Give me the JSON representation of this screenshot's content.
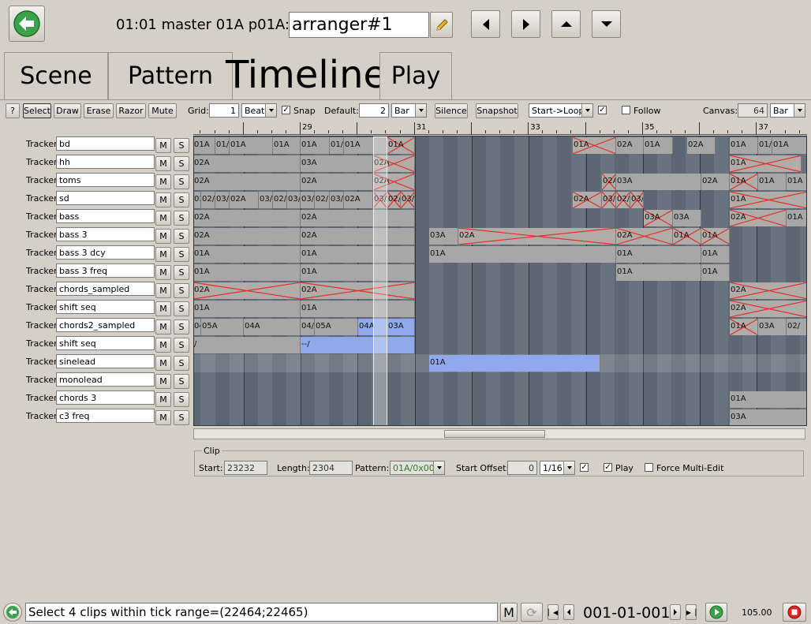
{
  "header": {
    "location_label": "01:01 master 01A p01A:",
    "name_value": "arranger#1"
  },
  "tabs": [
    {
      "label": "Scene"
    },
    {
      "label": "Pattern"
    },
    {
      "label": "Timeline"
    },
    {
      "label": "Play"
    }
  ],
  "toolbar": {
    "help": "?",
    "select": "Select",
    "draw": "Draw",
    "erase": "Erase",
    "razor": "Razor",
    "mute": "Mute",
    "grid_label": "Grid:",
    "grid_value": "1",
    "grid_unit": "Beat",
    "snap_label": "Snap",
    "snap_checked": true,
    "default_label": "Default:",
    "default_value": "2",
    "default_unit": "Bar",
    "silence": "Silence",
    "snapshot": "Snapshot",
    "loop_mode": "Start->Loop",
    "loop_checked": true,
    "follow_label": "Follow",
    "follow_checked": false,
    "canvas_label": "Canvas:",
    "canvas_value": "64",
    "canvas_unit": "Bar"
  },
  "ruler": {
    "bars": [
      "29",
      "31",
      "33",
      "35",
      "37"
    ]
  },
  "tracks": [
    {
      "type": "Tracker",
      "name": "bd",
      "mute": "M",
      "solo": "S"
    },
    {
      "type": "Tracker",
      "name": "hh",
      "mute": "M",
      "solo": "S"
    },
    {
      "type": "Tracker",
      "name": "toms",
      "mute": "M",
      "solo": "S"
    },
    {
      "type": "Tracker",
      "name": "sd",
      "mute": "M",
      "solo": "S"
    },
    {
      "type": "Tracker",
      "name": "bass",
      "mute": "M",
      "solo": "S"
    },
    {
      "type": "Tracker",
      "name": "bass 3",
      "mute": "M",
      "solo": "S"
    },
    {
      "type": "Tracker",
      "name": "bass 3 dcy",
      "mute": "M",
      "solo": "S"
    },
    {
      "type": "Tracker",
      "name": "bass 3 freq",
      "mute": "M",
      "solo": "S"
    },
    {
      "type": "Tracker",
      "name": "chords_sampled",
      "mute": "M",
      "solo": "S"
    },
    {
      "type": "Tracker",
      "name": "shift seq",
      "mute": "M",
      "solo": "S"
    },
    {
      "type": "Tracker",
      "name": "chords2_sampled",
      "mute": "M",
      "solo": "S"
    },
    {
      "type": "Tracker",
      "name": "shift seq",
      "mute": "M",
      "solo": "S"
    },
    {
      "type": "Tracker",
      "name": "sinelead",
      "mute": "M",
      "solo": "S"
    },
    {
      "type": "Tracker",
      "name": "monolead",
      "mute": "M",
      "solo": "S"
    },
    {
      "type": "Tracker",
      "name": "chords 3",
      "mute": "M",
      "solo": "S"
    },
    {
      "type": "Tracker",
      "name": "c3 freq",
      "mute": "M",
      "solo": "S"
    }
  ],
  "clips": [
    {
      "t": 0,
      "s": 244,
      "e": 272,
      "l": "01A"
    },
    {
      "t": 0,
      "s": 272,
      "e": 290,
      "l": "01/"
    },
    {
      "t": 0,
      "s": 290,
      "e": 345,
      "l": "01A"
    },
    {
      "t": 0,
      "s": 345,
      "e": 380,
      "l": "01A"
    },
    {
      "t": 0,
      "s": 380,
      "e": 417,
      "l": "01A"
    },
    {
      "t": 0,
      "s": 417,
      "e": 435,
      "l": "01/"
    },
    {
      "t": 0,
      "s": 435,
      "e": 490,
      "l": "01A"
    },
    {
      "t": 0,
      "s": 490,
      "e": 525,
      "l": "01A",
      "m": true
    },
    {
      "t": 0,
      "s": 725,
      "e": 780,
      "l": "01A",
      "m": true
    },
    {
      "t": 0,
      "s": 780,
      "e": 815,
      "l": "02A"
    },
    {
      "t": 0,
      "s": 815,
      "e": 852,
      "l": "01A"
    },
    {
      "t": 0,
      "s": 870,
      "e": 906,
      "l": "02A"
    },
    {
      "t": 0,
      "s": 924,
      "e": 960,
      "l": "01A"
    },
    {
      "t": 0,
      "s": 960,
      "e": 978,
      "l": "01/"
    },
    {
      "t": 0,
      "s": 978,
      "e": 1023,
      "l": "01A"
    },
    {
      "t": 1,
      "s": 244,
      "e": 380,
      "l": "02A"
    },
    {
      "t": 1,
      "s": 380,
      "e": 472,
      "l": "03A"
    },
    {
      "t": 1,
      "s": 472,
      "e": 525,
      "l": "02A",
      "m": true
    },
    {
      "t": 1,
      "s": 924,
      "e": 1015,
      "l": "01A",
      "m": true
    },
    {
      "t": 2,
      "s": 244,
      "e": 380,
      "l": "02A"
    },
    {
      "t": 2,
      "s": 380,
      "e": 472,
      "l": "02A"
    },
    {
      "t": 2,
      "s": 472,
      "e": 525,
      "l": "02A",
      "m": true
    },
    {
      "t": 2,
      "s": 762,
      "e": 780,
      "l": "02A",
      "m": true
    },
    {
      "t": 2,
      "s": 780,
      "e": 888,
      "l": "03A"
    },
    {
      "t": 2,
      "s": 888,
      "e": 924,
      "l": "02A"
    },
    {
      "t": 2,
      "s": 924,
      "e": 960,
      "l": "01A",
      "m": true
    },
    {
      "t": 2,
      "s": 960,
      "e": 996,
      "l": "01A"
    },
    {
      "t": 2,
      "s": 996,
      "e": 1023,
      "l": "01A"
    },
    {
      "t": 3,
      "s": 244,
      "e": 254,
      "l": "03/"
    },
    {
      "t": 3,
      "s": 254,
      "e": 272,
      "l": "02/"
    },
    {
      "t": 3,
      "s": 272,
      "e": 290,
      "l": "03/"
    },
    {
      "t": 3,
      "s": 290,
      "e": 327,
      "l": "02A"
    },
    {
      "t": 3,
      "s": 327,
      "e": 345,
      "l": "03/"
    },
    {
      "t": 3,
      "s": 345,
      "e": 363,
      "l": "02/"
    },
    {
      "t": 3,
      "s": 363,
      "e": 380,
      "l": "03/"
    },
    {
      "t": 3,
      "s": 380,
      "e": 398,
      "l": "03/"
    },
    {
      "t": 3,
      "s": 398,
      "e": 417,
      "l": "02/"
    },
    {
      "t": 3,
      "s": 417,
      "e": 435,
      "l": "03/"
    },
    {
      "t": 3,
      "s": 435,
      "e": 472,
      "l": "02A"
    },
    {
      "t": 3,
      "s": 472,
      "e": 490,
      "l": "03/",
      "m": true
    },
    {
      "t": 3,
      "s": 490,
      "e": 507,
      "l": "02/",
      "m": true
    },
    {
      "t": 3,
      "s": 507,
      "e": 525,
      "l": "03/",
      "m": true
    },
    {
      "t": 3,
      "s": 725,
      "e": 762,
      "l": "02A",
      "m": true
    },
    {
      "t": 3,
      "s": 762,
      "e": 780,
      "l": "03/",
      "m": true
    },
    {
      "t": 3,
      "s": 780,
      "e": 798,
      "l": "02/",
      "m": true
    },
    {
      "t": 3,
      "s": 798,
      "e": 815,
      "l": "03/",
      "m": true
    },
    {
      "t": 3,
      "s": 924,
      "e": 1023,
      "l": "01A",
      "m": true
    },
    {
      "t": 4,
      "s": 244,
      "e": 380,
      "l": "02A"
    },
    {
      "t": 4,
      "s": 380,
      "e": 525,
      "l": "02A"
    },
    {
      "t": 4,
      "s": 815,
      "e": 852,
      "l": "03A",
      "m": true
    },
    {
      "t": 4,
      "s": 852,
      "e": 888,
      "l": "03A"
    },
    {
      "t": 4,
      "s": 924,
      "e": 996,
      "l": "02A",
      "m": true
    },
    {
      "t": 4,
      "s": 996,
      "e": 1023,
      "l": "01A"
    },
    {
      "t": 5,
      "s": 244,
      "e": 380,
      "l": "02A"
    },
    {
      "t": 5,
      "s": 380,
      "e": 525,
      "l": "02A"
    },
    {
      "t": 5,
      "s": 543,
      "e": 580,
      "l": "03A"
    },
    {
      "t": 5,
      "s": 580,
      "e": 780,
      "l": "02A",
      "m": true
    },
    {
      "t": 5,
      "s": 780,
      "e": 852,
      "l": "02A",
      "m": true
    },
    {
      "t": 5,
      "s": 852,
      "e": 888,
      "l": "01A",
      "m": true
    },
    {
      "t": 5,
      "s": 888,
      "e": 924,
      "l": "01A",
      "m": true
    },
    {
      "t": 6,
      "s": 244,
      "e": 380,
      "l": "01A"
    },
    {
      "t": 6,
      "s": 380,
      "e": 525,
      "l": "01A"
    },
    {
      "t": 6,
      "s": 543,
      "e": 780,
      "l": "01A"
    },
    {
      "t": 6,
      "s": 780,
      "e": 888,
      "l": "01A"
    },
    {
      "t": 6,
      "s": 888,
      "e": 924,
      "l": "01A"
    },
    {
      "t": 7,
      "s": 244,
      "e": 380,
      "l": "01A"
    },
    {
      "t": 7,
      "s": 380,
      "e": 525,
      "l": "01A"
    },
    {
      "t": 7,
      "s": 780,
      "e": 888,
      "l": "01A"
    },
    {
      "t": 7,
      "s": 888,
      "e": 924,
      "l": "01A"
    },
    {
      "t": 8,
      "s": 244,
      "e": 380,
      "l": "02A",
      "m": true
    },
    {
      "t": 8,
      "s": 380,
      "e": 525,
      "l": "02A",
      "m": true
    },
    {
      "t": 8,
      "s": 924,
      "e": 1023,
      "l": "02A",
      "m": true
    },
    {
      "t": 9,
      "s": 244,
      "e": 380,
      "l": "01A"
    },
    {
      "t": 9,
      "s": 380,
      "e": 525,
      "l": "01A"
    },
    {
      "t": 9,
      "s": 924,
      "e": 1023,
      "l": "02A",
      "m": true
    },
    {
      "t": 10,
      "s": 244,
      "e": 254,
      "l": "04/"
    },
    {
      "t": 10,
      "s": 254,
      "e": 308,
      "l": "05A"
    },
    {
      "t": 10,
      "s": 308,
      "e": 380,
      "l": "04A"
    },
    {
      "t": 10,
      "s": 380,
      "e": 398,
      "l": "04/"
    },
    {
      "t": 10,
      "s": 398,
      "e": 453,
      "l": "05A"
    },
    {
      "t": 10,
      "s": 453,
      "e": 490,
      "l": "04A",
      "b": true
    },
    {
      "t": 10,
      "s": 490,
      "e": 525,
      "l": "03A",
      "b": true
    },
    {
      "t": 10,
      "s": 924,
      "e": 960,
      "l": "01A",
      "m": true
    },
    {
      "t": 10,
      "s": 960,
      "e": 996,
      "l": "03A"
    },
    {
      "t": 10,
      "s": 996,
      "e": 1023,
      "l": "02/"
    },
    {
      "t": 11,
      "s": 244,
      "e": 380,
      "l": "/"
    },
    {
      "t": 11,
      "s": 380,
      "e": 525,
      "l": "--/",
      "b": true
    },
    {
      "t": 12,
      "s": 543,
      "e": 760,
      "l": "01A",
      "b": true
    },
    {
      "t": 14,
      "s": 924,
      "e": 1023,
      "l": "01A"
    },
    {
      "t": 15,
      "s": 924,
      "e": 1023,
      "l": "03A"
    }
  ],
  "clip_panel": {
    "title": "Clip",
    "start_label": "Start:",
    "start_value": "23232",
    "length_label": "Length:",
    "length_value": "2304",
    "pattern_label": "Pattern:",
    "pattern_value": "01A/0x00",
    "offset_label": "Start Offset:",
    "offset_value": "0",
    "offset_unit": "1/16",
    "offset_checked": true,
    "play_label": "Play",
    "play_checked": true,
    "force_label": "Force Multi-Edit",
    "force_checked": false
  },
  "status": {
    "message": "Select 4 clips within tick range=(22464;22465)",
    "m_label": "M",
    "position": "001-01-001",
    "tempo": "105.00"
  },
  "colors": {
    "clip": "#a7a7a7",
    "clip_selected": "#8fa9ec",
    "mute_cross": "#e0302c",
    "timeline_bg": "#5a6470"
  }
}
